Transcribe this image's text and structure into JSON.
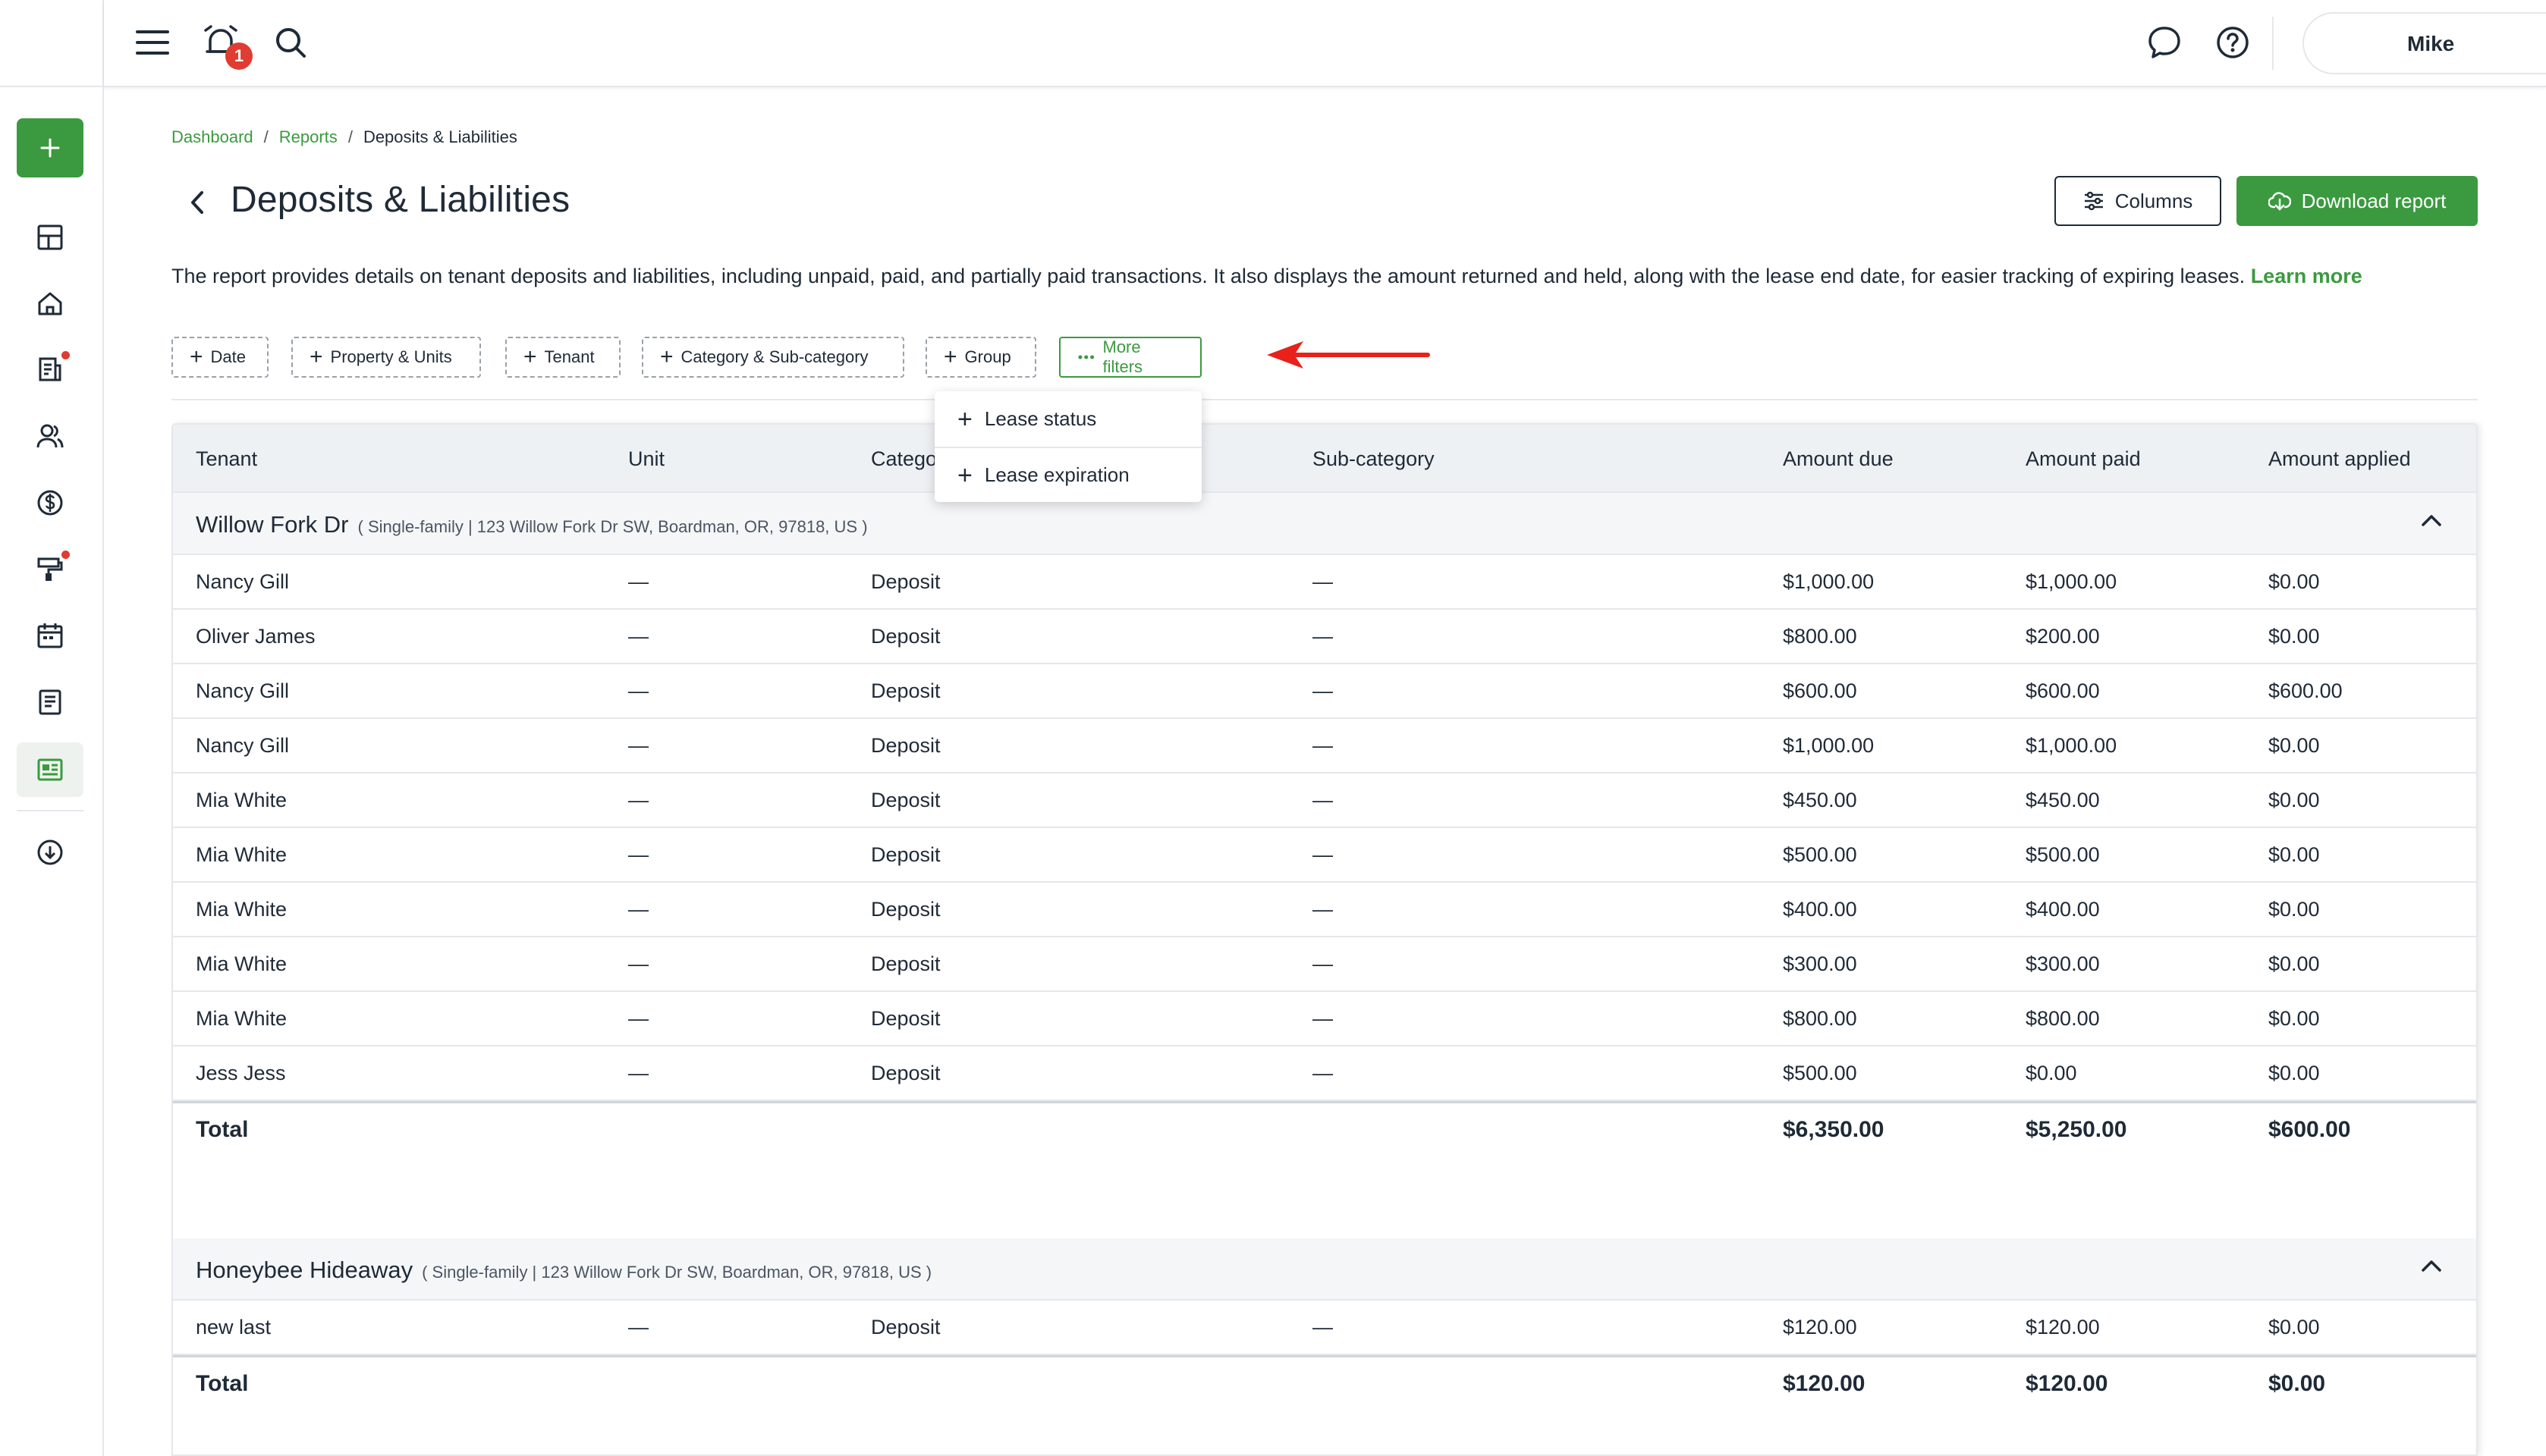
{
  "header": {
    "notification_count": "1",
    "user_name": "Mike"
  },
  "breadcrumb": {
    "items": [
      "Dashboard",
      "Reports"
    ],
    "current": "Deposits & Liabilities",
    "separator": "/"
  },
  "page": {
    "title": "Deposits & Liabilities",
    "description": "The report provides details on tenant deposits and liabilities, including unpaid, paid, and partially paid transactions. It also displays the amount returned and held, along with the lease end date, for easier tracking of expiring leases.",
    "learn_more": "Learn more",
    "columns_button": "Columns",
    "download_button": "Download report"
  },
  "filters": {
    "chips": [
      "Date",
      "Property & Units",
      "Tenant",
      "Category & Sub-category",
      "Group"
    ],
    "more_filters": "More filters",
    "dropdown": [
      "Lease status",
      "Lease expiration"
    ]
  },
  "table": {
    "columns": [
      "Tenant",
      "Unit",
      "Catego",
      "Sub-category",
      "Amount due",
      "Amount paid",
      "Amount applied"
    ],
    "groups": [
      {
        "name": "Willow Fork Dr",
        "details": "( Single-family | 123 Willow Fork Dr SW, Boardman, OR, 97818, US )",
        "rows": [
          [
            "Nancy Gill",
            "—",
            "Deposit",
            "—",
            "$1,000.00",
            "$1,000.00",
            "$0.00"
          ],
          [
            "Oliver James",
            "—",
            "Deposit",
            "—",
            "$800.00",
            "$200.00",
            "$0.00"
          ],
          [
            "Nancy Gill",
            "—",
            "Deposit",
            "—",
            "$600.00",
            "$600.00",
            "$600.00"
          ],
          [
            "Nancy Gill",
            "—",
            "Deposit",
            "—",
            "$1,000.00",
            "$1,000.00",
            "$0.00"
          ],
          [
            "Mia White",
            "—",
            "Deposit",
            "—",
            "$450.00",
            "$450.00",
            "$0.00"
          ],
          [
            "Mia White",
            "—",
            "Deposit",
            "—",
            "$500.00",
            "$500.00",
            "$0.00"
          ],
          [
            "Mia White",
            "—",
            "Deposit",
            "—",
            "$400.00",
            "$400.00",
            "$0.00"
          ],
          [
            "Mia White",
            "—",
            "Deposit",
            "—",
            "$300.00",
            "$300.00",
            "$0.00"
          ],
          [
            "Mia White",
            "—",
            "Deposit",
            "—",
            "$800.00",
            "$800.00",
            "$0.00"
          ],
          [
            "Jess Jess",
            "—",
            "Deposit",
            "—",
            "$500.00",
            "$0.00",
            "$0.00"
          ]
        ],
        "total": {
          "label": "Total",
          "due": "$6,350.00",
          "paid": "$5,250.00",
          "applied": "$600.00"
        }
      },
      {
        "name": "Honeybee Hideaway",
        "details": "( Single-family | 123 Willow Fork Dr SW, Boardman, OR, 97818, US )",
        "rows": [
          [
            "new last",
            "—",
            "Deposit",
            "—",
            "$120.00",
            "$120.00",
            "$0.00"
          ]
        ],
        "total": {
          "label": "Total",
          "due": "$120.00",
          "paid": "$120.00",
          "applied": "$0.00"
        }
      }
    ]
  },
  "colors": {
    "accent": "#3b9a3f",
    "badge": "#e03c31",
    "arrow": "#e8211b"
  },
  "icons": {
    "sidebar": [
      "plus-icon",
      "dashboard-icon",
      "home-icon",
      "leases-icon",
      "people-icon",
      "dollar-icon",
      "maintenance-icon",
      "calendar-icon",
      "document-icon",
      "reports-icon",
      "download-icon"
    ]
  }
}
